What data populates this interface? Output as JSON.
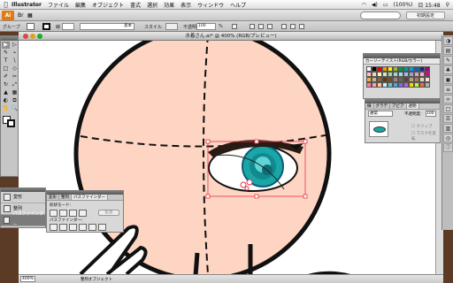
{
  "menubar": {
    "apple": "",
    "app_name": "Illustrator",
    "items": [
      "ファイル",
      "編集",
      "オブジェクト",
      "書式",
      "選択",
      "効果",
      "表示",
      "ウィンドウ",
      "ヘルプ"
    ],
    "battery": "(100%)",
    "clock": "日 15:48"
  },
  "control_bar": {
    "app_icon": "Ai",
    "workspace": "初期設定"
  },
  "options_bar": {
    "selection_label": "グループ",
    "stroke_label": "線",
    "basic_label": "基本",
    "style_label": "スタイル",
    "opacity_label": "不透明度",
    "opacity_value": "100",
    "opacity_unit": "%"
  },
  "document": {
    "title": "水着さん.ai* @ 400% (RGB/プレビュー)",
    "zoom": "400%",
    "status_info": "整列オブジェクト"
  },
  "tools": {
    "items": [
      "▶",
      "▷",
      "✎",
      "⌁",
      "T",
      "\\",
      "□",
      "◇",
      "✐",
      "✂",
      "↻",
      "⤢",
      "▲",
      "▦",
      "◐",
      "⧉",
      "✋",
      "🔍"
    ]
  },
  "swatch_panel": {
    "title": "カーリーテイスト(RGB/カラー)",
    "colors": [
      "#ffffff",
      "#000000",
      "#e60012",
      "#f39800",
      "#fff100",
      "#8fc31f",
      "#009944",
      "#009e96",
      "#00a0e9",
      "#0068b7",
      "#1d2088",
      "#920783",
      "#f9c1cf",
      "#fad6a5",
      "#fff5b1",
      "#d7e7af",
      "#a5d4ad",
      "#a3d6cc",
      "#a0d8ef",
      "#a3bce2",
      "#a59aca",
      "#cfa7cd",
      "#f4b3c2",
      "#e4007f",
      "#f6ad3c",
      "#c7b299",
      "#8c6239",
      "#603813",
      "#754c24",
      "#998675",
      "#736357",
      "#534741",
      "#c69c6d",
      "#a67c52",
      "#e9d5c0",
      "#f5e1d0",
      "#ff7bac",
      "#ff9f9f",
      "#ffc5a1",
      "#c9f0ff",
      "#5cc8c8",
      "#3fa9f5",
      "#7b68ee",
      "#c061cb",
      "#ffd700",
      "#adff2f",
      "#ff6347",
      "#b0b0b0"
    ]
  },
  "transparency_panel": {
    "tabs": [
      "線",
      "グラデ",
      "アピア",
      "透明"
    ],
    "blend_mode": "通常",
    "opacity_label": "不透明度:",
    "opacity_value": "100",
    "clip_label": "クリップ",
    "invert_label": "マスクを反転"
  },
  "left_panel": {
    "items": [
      "変形",
      "整列",
      "パスファインダー"
    ]
  },
  "pathfinder_panel": {
    "tabs": [
      "変形",
      "整列",
      "パスファインダー"
    ],
    "shape_modes_label": "形状モード:",
    "pathfinders_label": "パスファインダー:",
    "expand_label": "拡張"
  },
  "colors": {
    "skin": "#fdd5c2",
    "iris": "#1aa6a6",
    "selection": "#e8334a"
  }
}
